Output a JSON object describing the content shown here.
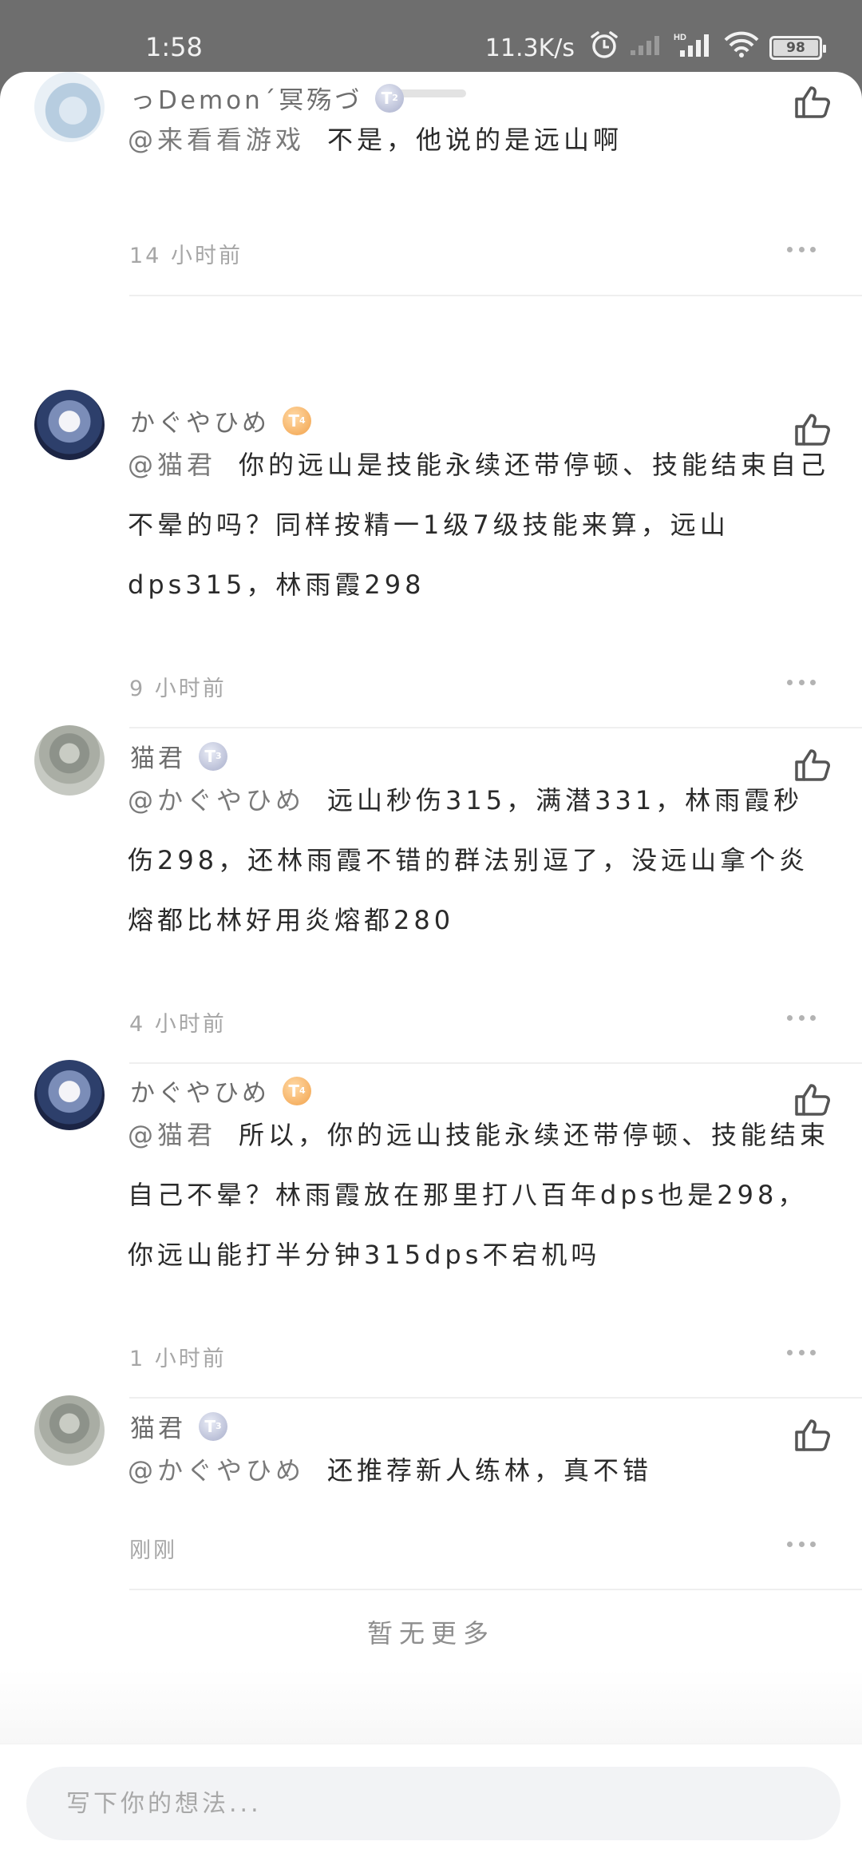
{
  "status_bar": {
    "time": "1:58",
    "net_speed": "11.3K/s",
    "battery": "98"
  },
  "comments": [
    {
      "username": "っDemon´冥殇づ",
      "badge": "T",
      "badge_level": "2",
      "mention": "@来看看游戏",
      "text": "不是，他说的是远山啊",
      "time": "14 小时前"
    },
    {
      "username": "かぐやひめ",
      "badge": "T",
      "badge_level": "4",
      "mention": "@猫君",
      "text": "你的远山是技能永续还带停顿、技能结束自己不晕的吗？同样按精一1级7级技能来算，远山dps315，林雨霞298",
      "time": "9 小时前"
    },
    {
      "username": "猫君",
      "badge": "T",
      "badge_level": "3",
      "mention": "@かぐやひめ",
      "text": "远山秒伤315，满潜331，林雨霞秒伤298，还林雨霞不错的群法别逗了，没远山拿个炎熔都比林好用炎熔都280",
      "time": "4 小时前"
    },
    {
      "username": "かぐやひめ",
      "badge": "T",
      "badge_level": "4",
      "mention": "@猫君",
      "text": "所以，你的远山技能永续还带停顿、技能结束自己不晕？林雨霞放在那里打八百年dps也是298，你远山能打半分钟315dps不宕机吗",
      "time": "1 小时前"
    },
    {
      "username": "猫君",
      "badge": "T",
      "badge_level": "3",
      "mention": "@かぐやひめ",
      "text": "还推荐新人练林，真不错",
      "time": "刚刚"
    }
  ],
  "footer": {
    "no_more": "暂无更多",
    "input_placeholder": "写下你的想法..."
  }
}
